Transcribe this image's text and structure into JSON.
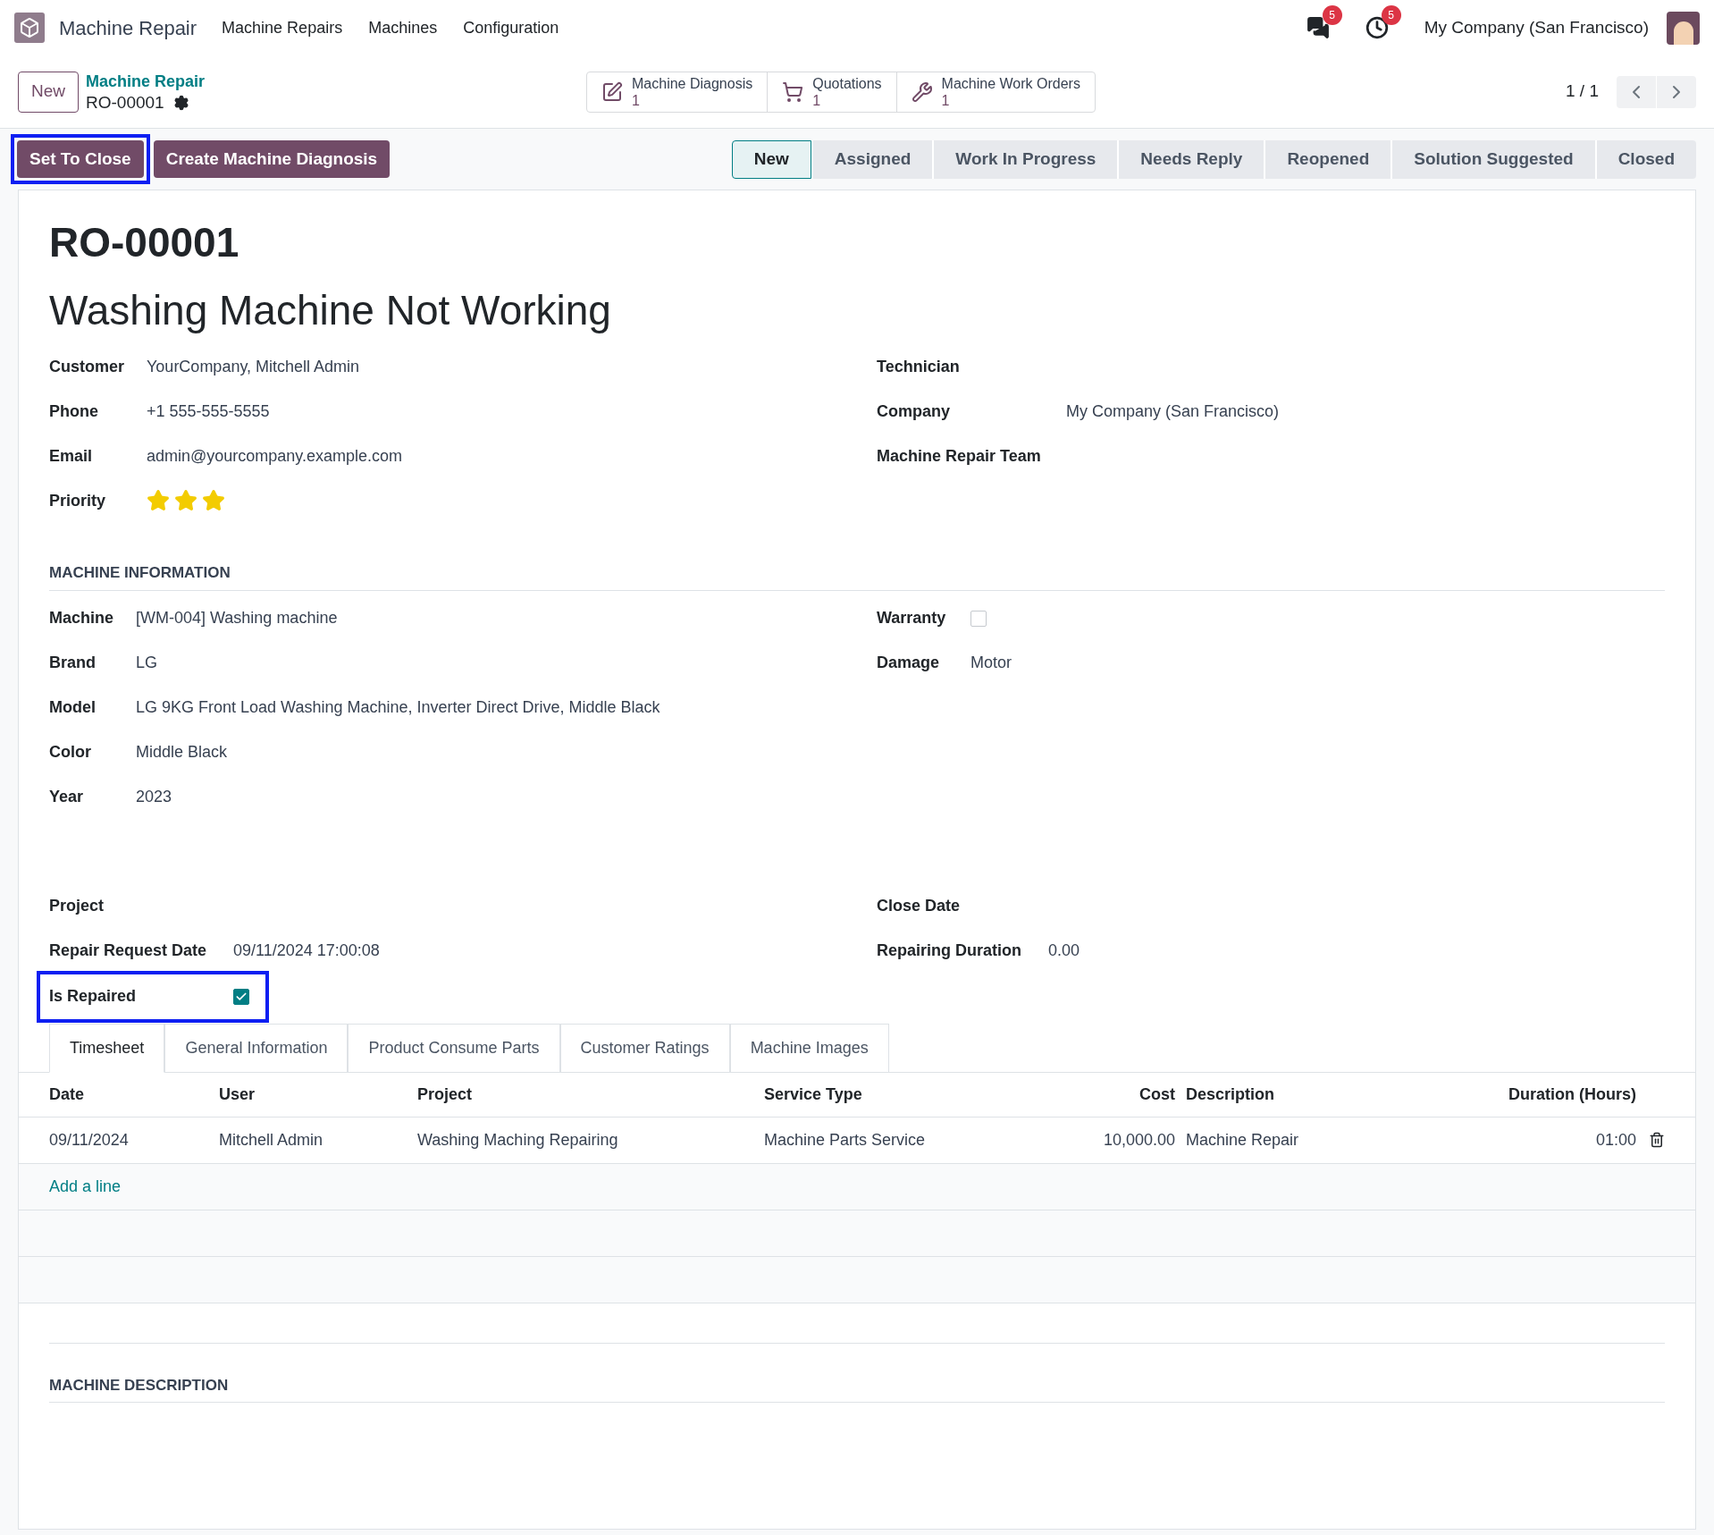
{
  "navbar": {
    "app_name": "Machine Repair",
    "menu": [
      "Machine Repairs",
      "Machines",
      "Configuration"
    ],
    "messages_count": "5",
    "activities_count": "5",
    "company": "My Company (San Francisco)"
  },
  "control_panel": {
    "new_button": "New",
    "breadcrumb": "Machine Repair",
    "record": "RO-00001",
    "smart_buttons": [
      {
        "kind": "diagnosis",
        "label": "Machine Diagnosis",
        "count": "1"
      },
      {
        "kind": "quotation",
        "label": "Quotations",
        "count": "1"
      },
      {
        "kind": "workorder",
        "label": "Machine Work Orders",
        "count": "1"
      }
    ],
    "pager": "1 / 1"
  },
  "actions": [
    {
      "label": "Set To Close",
      "highlighted": true
    },
    {
      "label": "Create Machine Diagnosis",
      "highlighted": false
    }
  ],
  "stages": [
    {
      "label": "New",
      "selected": true
    },
    {
      "label": "Assigned",
      "selected": false
    },
    {
      "label": "Work In Progress",
      "selected": false
    },
    {
      "label": "Needs Reply",
      "selected": false
    },
    {
      "label": "Reopened",
      "selected": false
    },
    {
      "label": "Solution Suggested",
      "selected": false
    },
    {
      "label": "Closed",
      "selected": false
    }
  ],
  "record": {
    "reference": "RO-00001",
    "title": "Washing Machine Not Working",
    "left_fields": [
      {
        "label": "Customer",
        "value": "YourCompany, Mitchell Admin"
      },
      {
        "label": "Phone",
        "value": "+1 555-555-5555"
      },
      {
        "label": "Email",
        "value": "admin@yourcompany.example.com"
      }
    ],
    "priority": {
      "label": "Priority",
      "stars": 3
    },
    "right_fields": [
      {
        "label": "Technician"
      },
      {
        "label": "Company",
        "value": "My Company (San Francisco)"
      },
      {
        "label": "Machine Repair Team"
      }
    ],
    "machine_section": "MACHINE INFORMATION",
    "machine_fields": [
      {
        "label": "Machine",
        "value": "[WM-004] Washing machine"
      },
      {
        "label": "Brand",
        "value": "LG"
      },
      {
        "label": "Model",
        "value": "LG 9KG Front Load Washing Machine, Inverter Direct Drive, Middle Black"
      },
      {
        "label": "Color",
        "value": "Middle Black"
      },
      {
        "label": "Year",
        "value": "2023"
      }
    ],
    "warranty": {
      "label": "Warranty",
      "checked": false
    },
    "damage": {
      "label": "Damage",
      "value": "Motor"
    },
    "project": {
      "label": "Project"
    },
    "repair_request_date": {
      "label": "Repair Request Date",
      "value": "09/11/2024 17:00:08"
    },
    "is_repaired": {
      "label": "Is Repaired",
      "checked": true,
      "highlighted": true
    },
    "close_date": {
      "label": "Close Date"
    },
    "repairing_duration": {
      "label": "Repairing Duration",
      "value": "0.00"
    }
  },
  "tabs": [
    {
      "label": "Timesheet",
      "selected": true
    },
    {
      "label": "General Information",
      "selected": false
    },
    {
      "label": "Product Consume Parts",
      "selected": false
    },
    {
      "label": "Customer Ratings",
      "selected": false
    },
    {
      "label": "Machine Images",
      "selected": false
    }
  ],
  "table": {
    "columns": [
      "Date",
      "User",
      "Project",
      "Service Type",
      "Cost",
      "Description",
      "Duration (Hours)"
    ],
    "rows": [
      [
        "09/11/2024",
        "Mitchell Admin",
        "Washing Maching Repairing",
        "Machine Parts Service",
        "10,000.00",
        "Machine Repair",
        "01:00"
      ]
    ],
    "add_line": "Add a line"
  },
  "description_section": "MACHINE DESCRIPTION"
}
